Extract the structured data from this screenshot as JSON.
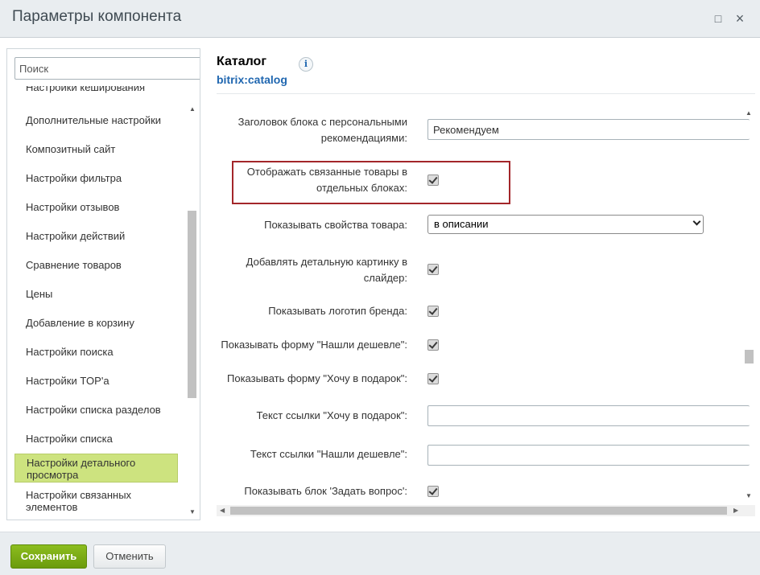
{
  "window": {
    "title": "Параметры компонента",
    "maximize_icon": "□",
    "close_icon": "×"
  },
  "sidebar": {
    "search_placeholder": "Поиск",
    "partial_item": "Настройки кеширования",
    "items": [
      {
        "label": "Дополнительные настройки"
      },
      {
        "label": "Композитный сайт"
      },
      {
        "label": "Настройки фильтра"
      },
      {
        "label": "Настройки отзывов"
      },
      {
        "label": "Настройки действий"
      },
      {
        "label": "Сравнение товаров"
      },
      {
        "label": "Цены"
      },
      {
        "label": "Добавление в корзину"
      },
      {
        "label": "Настройки поиска"
      },
      {
        "label": "Настройки TOP'а"
      },
      {
        "label": "Настройки списка разделов"
      },
      {
        "label": "Настройки списка"
      },
      {
        "label": "Настройки детального просмотра",
        "active": true
      },
      {
        "label": "Настройки связанных элементов"
      }
    ]
  },
  "header": {
    "title": "Каталог",
    "subtitle": "bitrix:catalog",
    "info_icon": "i"
  },
  "params": {
    "personal_rec_title": {
      "label": "Заголовок блока с персональными рекомендациями:",
      "value": "Рекомендуем"
    },
    "show_linked_blocks": {
      "label": "Отображать связанные товары в отдельных блоках:",
      "checked": true
    },
    "show_props": {
      "label": "Показывать свойства товара:",
      "value": "в описании"
    },
    "add_detail_picture": {
      "label": "Добавлять детальную картинку в слайдер:",
      "checked": true
    },
    "show_brand_logo": {
      "label": "Показывать логотип бренда:",
      "checked": true
    },
    "show_cheaper_form": {
      "label": "Показывать форму \"Нашли дешевле\":",
      "checked": true
    },
    "show_gift_form": {
      "label": "Показывать форму \"Хочу в подарок\":",
      "checked": true
    },
    "gift_link_text": {
      "label": "Текст ссылки \"Хочу в подарок\":",
      "value": ""
    },
    "cheaper_link_text": {
      "label": "Текст ссылки \"Нашли дешевле\":",
      "value": ""
    },
    "show_question_block": {
      "label": "Показывать блок 'Задать вопрос':",
      "checked": true
    }
  },
  "footer": {
    "save_label": "Сохранить",
    "cancel_label": "Отменить"
  },
  "colors": {
    "accent_green": "#76a812",
    "active_item_bg": "#cde37f",
    "link_blue": "#2067b0",
    "highlight_red": "#a3262a"
  }
}
